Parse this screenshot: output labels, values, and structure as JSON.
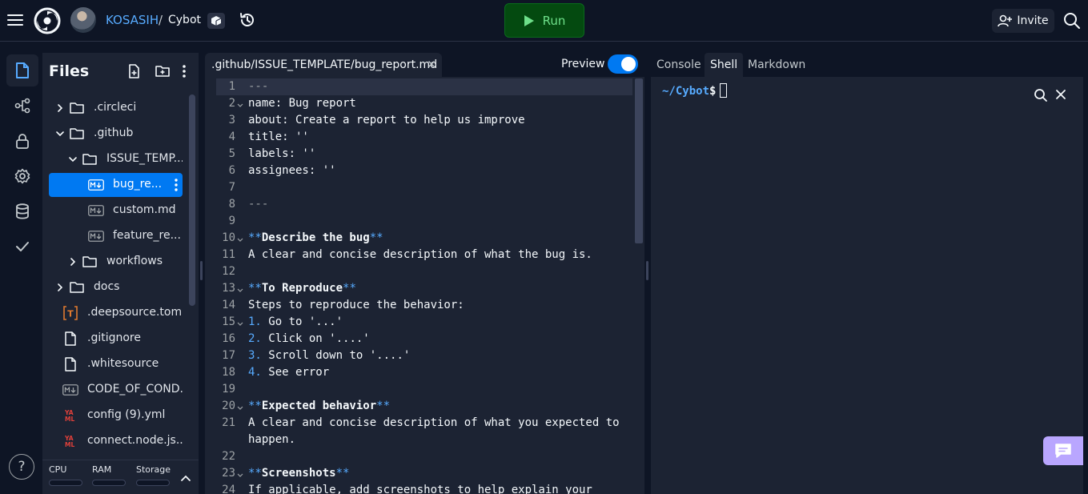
{
  "topbar": {
    "owner": "KOSASIH",
    "separator": "/",
    "repl_name": "Cybot",
    "run_label": "Run",
    "invite_label": "Invite",
    "colors": {
      "run_bg": "#044a10",
      "run_text": "#6ee08a",
      "accent": "#0079f2",
      "owner_link": "#57abff"
    }
  },
  "rail": {
    "items": [
      "files-icon",
      "git-branch-icon",
      "lock-icon",
      "gear-icon",
      "database-icon",
      "check-icon"
    ],
    "help_label": "?"
  },
  "files": {
    "title": "Files",
    "tree": [
      {
        "name": ".circleci",
        "type": "folder",
        "depth": 0,
        "expanded": false
      },
      {
        "name": ".github",
        "type": "folder",
        "depth": 0,
        "expanded": true
      },
      {
        "name": "ISSUE_TEMP...",
        "type": "folder",
        "depth": 1,
        "expanded": true
      },
      {
        "name": "bug_re...",
        "type": "markdown",
        "depth": 2,
        "selected": true
      },
      {
        "name": "custom.md",
        "type": "markdown",
        "depth": 2
      },
      {
        "name": "feature_re...",
        "type": "markdown",
        "depth": 2
      },
      {
        "name": "workflows",
        "type": "folder",
        "depth": 1,
        "expanded": false
      },
      {
        "name": "docs",
        "type": "folder",
        "depth": 0,
        "expanded": false
      },
      {
        "name": ".deepsource.toml",
        "type": "toml",
        "depth": 0
      },
      {
        "name": ".gitignore",
        "type": "file",
        "depth": 0
      },
      {
        "name": ".whitesource",
        "type": "file",
        "depth": 0
      },
      {
        "name": "CODE_OF_COND...",
        "type": "markdown",
        "depth": 0
      },
      {
        "name": "config (9).yml",
        "type": "yaml",
        "depth": 0
      },
      {
        "name": "connect.node.js....",
        "type": "yaml",
        "depth": 0
      }
    ],
    "resources": {
      "cpu": "CPU",
      "ram": "RAM",
      "storage": "Storage"
    }
  },
  "editor": {
    "tab_label": ".github/ISSUE_TEMPLATE/bug_report.md",
    "preview_label": "Preview",
    "preview_on": true,
    "lines": [
      {
        "n": "1",
        "fold": "",
        "text": "---",
        "style": "dash"
      },
      {
        "n": "2",
        "fold": "v",
        "text": "name: Bug report"
      },
      {
        "n": "3",
        "fold": "",
        "text": "about: Create a report to help us improve"
      },
      {
        "n": "4",
        "fold": "",
        "text": "title: ''"
      },
      {
        "n": "5",
        "fold": "",
        "text": "labels: ''"
      },
      {
        "n": "6",
        "fold": "",
        "text": "assignees: ''"
      },
      {
        "n": "7",
        "fold": "",
        "text": ""
      },
      {
        "n": "8",
        "fold": "",
        "text": "---",
        "style": "dash"
      },
      {
        "n": "9",
        "fold": "",
        "text": ""
      },
      {
        "n": "10",
        "fold": "v",
        "text": "Describe the bug",
        "style": "heading"
      },
      {
        "n": "11",
        "fold": "",
        "text": "A clear and concise description of what the bug is."
      },
      {
        "n": "12",
        "fold": "",
        "text": ""
      },
      {
        "n": "13",
        "fold": "v",
        "text": "To Reproduce",
        "style": "heading"
      },
      {
        "n": "14",
        "fold": "",
        "text": "Steps to reproduce the behavior:"
      },
      {
        "n": "15",
        "fold": "v",
        "marker": "1.",
        "text": "Go to '...'",
        "style": "list"
      },
      {
        "n": "16",
        "fold": "",
        "marker": "2.",
        "text": "Click on '....'",
        "style": "list"
      },
      {
        "n": "17",
        "fold": "",
        "marker": "3.",
        "text": "Scroll down to '....'",
        "style": "list"
      },
      {
        "n": "18",
        "fold": "",
        "marker": "4.",
        "text": "See error",
        "style": "list"
      },
      {
        "n": "19",
        "fold": "",
        "text": ""
      },
      {
        "n": "20",
        "fold": "v",
        "text": "Expected behavior",
        "style": "heading"
      },
      {
        "n": "21",
        "fold": "",
        "text": "A clear and concise description of what you expected to"
      },
      {
        "n": "",
        "fold": "",
        "text": "happen."
      },
      {
        "n": "22",
        "fold": "",
        "text": ""
      },
      {
        "n": "23",
        "fold": "v",
        "text": "Screenshots",
        "style": "heading"
      },
      {
        "n": "24",
        "fold": "",
        "text": "If applicable, add screenshots to help explain your"
      }
    ]
  },
  "shell": {
    "tabs": [
      "Console",
      "Shell",
      "Markdown"
    ],
    "active_tab": "Shell",
    "prompt_path": "~/Cybot",
    "prompt_symbol": "$"
  }
}
